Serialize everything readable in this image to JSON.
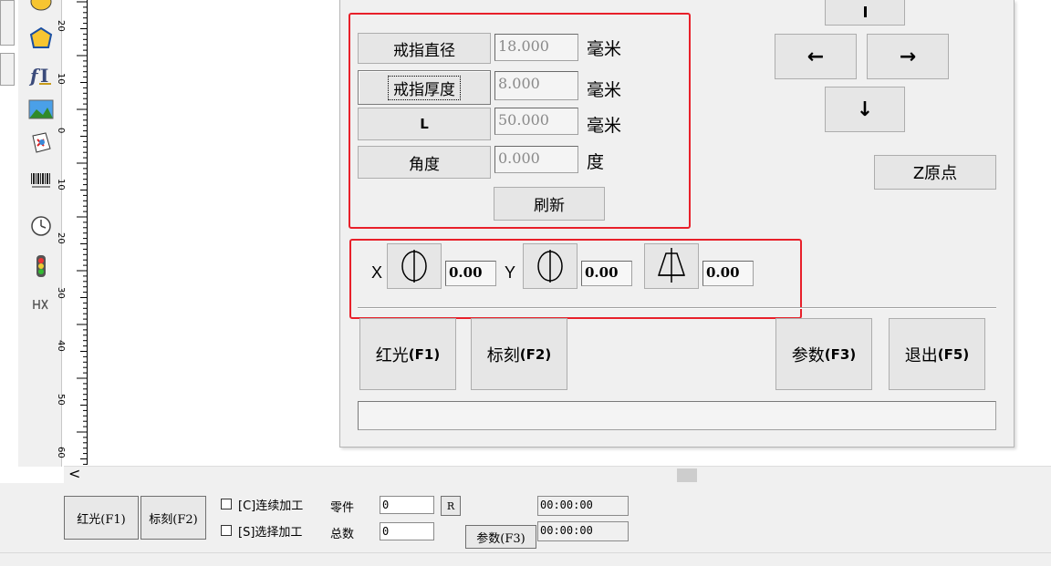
{
  "ring_panel": {
    "rows": [
      {
        "button": "戒指直径",
        "value": "18.000",
        "unit": "毫米"
      },
      {
        "button": "戒指厚度",
        "value": "8.000",
        "unit": "毫米"
      },
      {
        "button": "L",
        "value": "50.000",
        "unit": "毫米"
      },
      {
        "button": "角度",
        "value": "0.000",
        "unit": "度"
      }
    ],
    "refresh_label": "刷新"
  },
  "axis_panel": {
    "x_label": "X",
    "x_value": "0.00",
    "y_label": "Y",
    "y_value": "0.00",
    "z_value": "0.00"
  },
  "jog": {
    "left_arrow": "←",
    "right_arrow": "→",
    "down_arrow": "↓",
    "z_origin_label": "Z原点"
  },
  "actions": {
    "red_light": "红光",
    "red_light_key": "(F1)",
    "mark": "标刻",
    "mark_key": "(F2)",
    "params": "参数",
    "params_key": "(F3)",
    "exit": "退出",
    "exit_key": "(F5)"
  },
  "ruler_labels": [
    "20",
    "10",
    "0",
    "10",
    "20",
    "30",
    "40",
    "50",
    "60"
  ],
  "bottom": {
    "red_light_btn": "红光(F1)",
    "mark_btn": "标刻(F2)",
    "continuous_label": "[C]连续加工",
    "select_label": "[S]选择加工",
    "part_label": "零件",
    "total_label": "总数",
    "part_value": "0",
    "total_value": "0",
    "r_btn": "R",
    "params_btn": "参数(F3)",
    "time1": "00:00:00",
    "time2": "00:00:00"
  },
  "scroll": {
    "left_arrow": "<"
  }
}
